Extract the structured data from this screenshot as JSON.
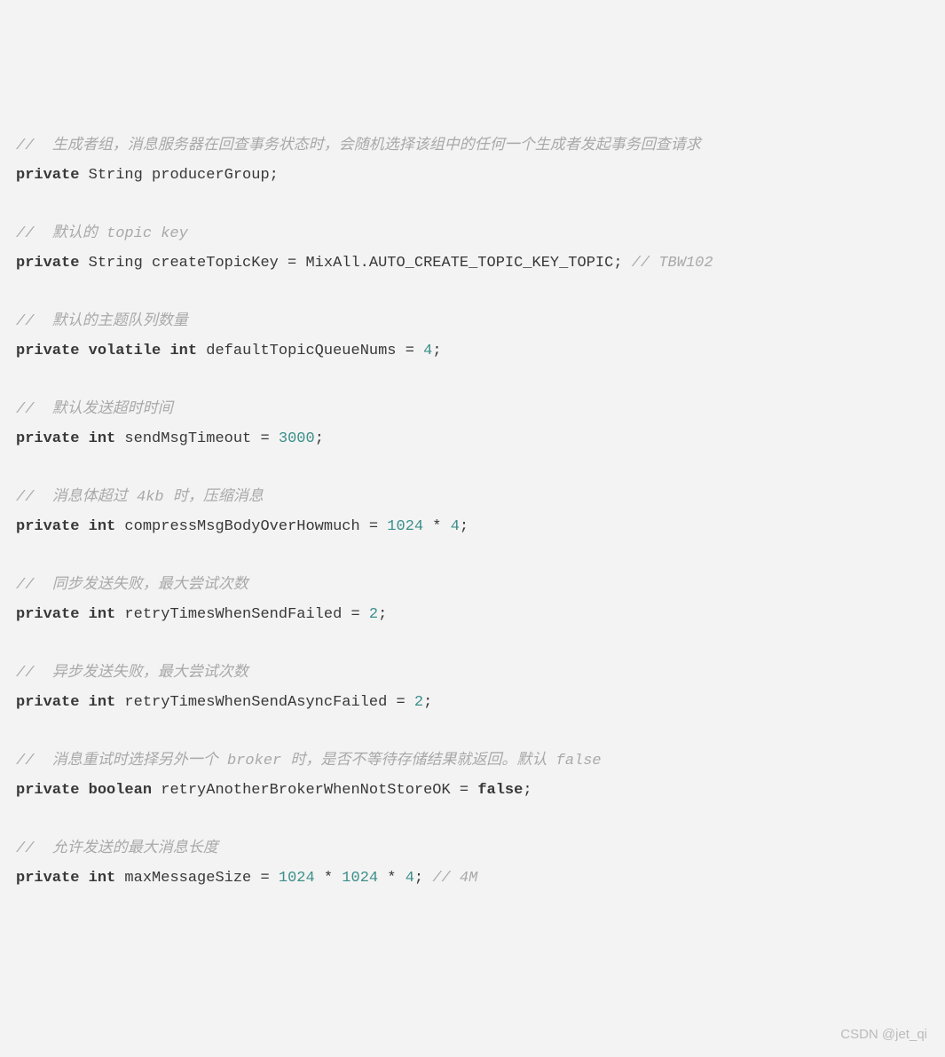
{
  "code": {
    "c1": "//  生成者组，消息服务器在回查事务状态时，会随机选择该组中的任何一个生成者发起事务回查请求",
    "l1a": "private",
    "l1b": " String producerGroup;",
    "c2": "//  默认的 topic key",
    "l2a": "private",
    "l2b": " String createTopicKey = MixAll.AUTO_CREATE_TOPIC_KEY_TOPIC; ",
    "l2c": "// TBW102",
    "c3": "//  默认的主题队列数量",
    "l3a": "private",
    "l3b": "volatile",
    "l3c": "int",
    "l3d": " defaultTopicQueueNums = ",
    "l3e": "4",
    "l3f": ";",
    "c4": "//  默认发送超时时间",
    "l4a": "private",
    "l4b": "int",
    "l4c": " sendMsgTimeout = ",
    "l4d": "3000",
    "l4e": ";",
    "c5": "//  消息体超过 4kb 时，压缩消息",
    "l5a": "private",
    "l5b": "int",
    "l5c": " compressMsgBodyOverHowmuch = ",
    "l5d": "1024",
    "l5e": " * ",
    "l5f": "4",
    "l5g": ";",
    "c6": "//  同步发送失败，最大尝试次数",
    "l6a": "private",
    "l6b": "int",
    "l6c": " retryTimesWhenSendFailed = ",
    "l6d": "2",
    "l6e": ";",
    "c7": "//  异步发送失败，最大尝试次数",
    "l7a": "private",
    "l7b": "int",
    "l7c": " retryTimesWhenSendAsyncFailed = ",
    "l7d": "2",
    "l7e": ";",
    "c8": "//  消息重试时选择另外一个 broker 时，是否不等待存储结果就返回。默认 false",
    "l8a": "private",
    "l8b": "boolean",
    "l8c": " retryAnotherBrokerWhenNotStoreOK = ",
    "l8d": "false",
    "l8e": ";",
    "c9": "//  允许发送的最大消息长度",
    "l9a": "private",
    "l9b": "int",
    "l9c": " maxMessageSize = ",
    "l9d": "1024",
    "l9e": " * ",
    "l9f": "1024",
    "l9g": " * ",
    "l9h": "4",
    "l9i": "; ",
    "l9j": "// 4M"
  },
  "watermark": "CSDN @jet_qi"
}
